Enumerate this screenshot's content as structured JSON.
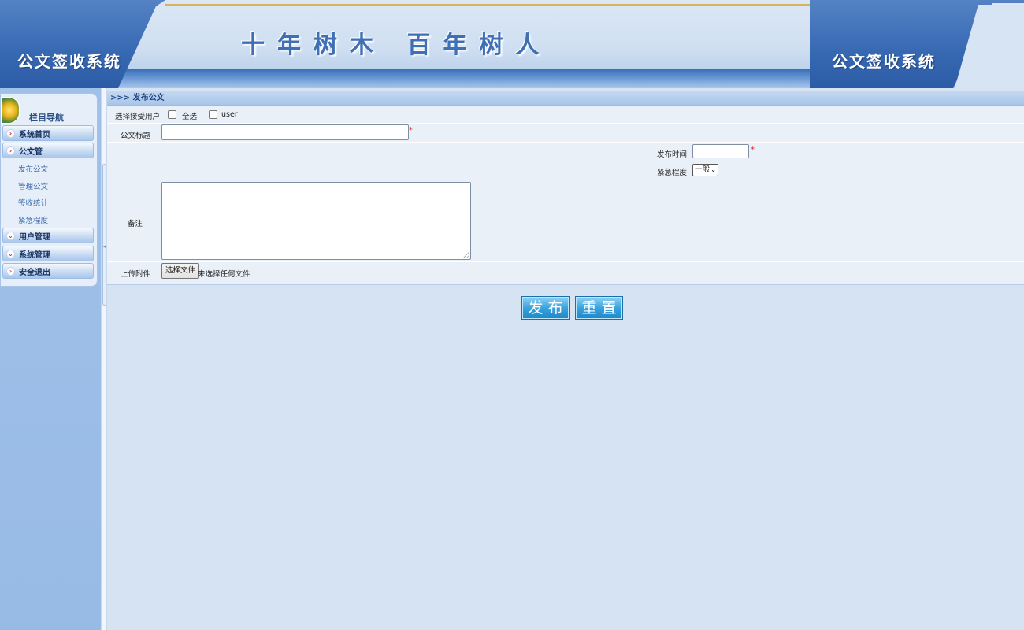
{
  "header": {
    "app_title_left": "公文签收系统",
    "app_title_right": "公文签收系统",
    "slogan": "十年树木 百年树人"
  },
  "sidebar": {
    "nav_title": "栏目导航",
    "groups": [
      {
        "label": "系统首页",
        "arrow": "›"
      },
      {
        "label": "公文管",
        "arrow": "›"
      },
      {
        "label": "用户管理",
        "arrow": "⌄"
      },
      {
        "label": "系统管理",
        "arrow": "⌄"
      },
      {
        "label": "安全退出",
        "arrow": "›"
      }
    ],
    "submenu": [
      "发布公文",
      "管理公文",
      "签收统计",
      "紧急程度"
    ]
  },
  "main": {
    "breadcrumb": ">>> 发布公文",
    "form": {
      "recipients_label": "选择接受用户",
      "select_all_label": "全选",
      "user_option_label": "user",
      "title_label": "公文标题",
      "title_value": "",
      "publish_time_label": "发布时间",
      "publish_time_value": "",
      "urgency_label": "紧急程度",
      "urgency_selected": "一般",
      "remark_label": "备注",
      "attachment_label": "上传附件",
      "file_button_label": "选择文件",
      "file_status": "未选择任何文件",
      "required_mark": "*"
    },
    "buttons": {
      "publish": "发布",
      "reset": "重置"
    }
  },
  "colors": {
    "header_blue": "#3768b2",
    "gold_accent": "#d7b45a",
    "page_background": "#d5e3f3",
    "button_blue": "#3aa2dc",
    "required_red": "#e02020"
  },
  "icons": {
    "nav_emblem": "nav-emblem-icon",
    "group_arrow": "chevron-right-icon",
    "group_expand": "chevron-down-icon"
  }
}
